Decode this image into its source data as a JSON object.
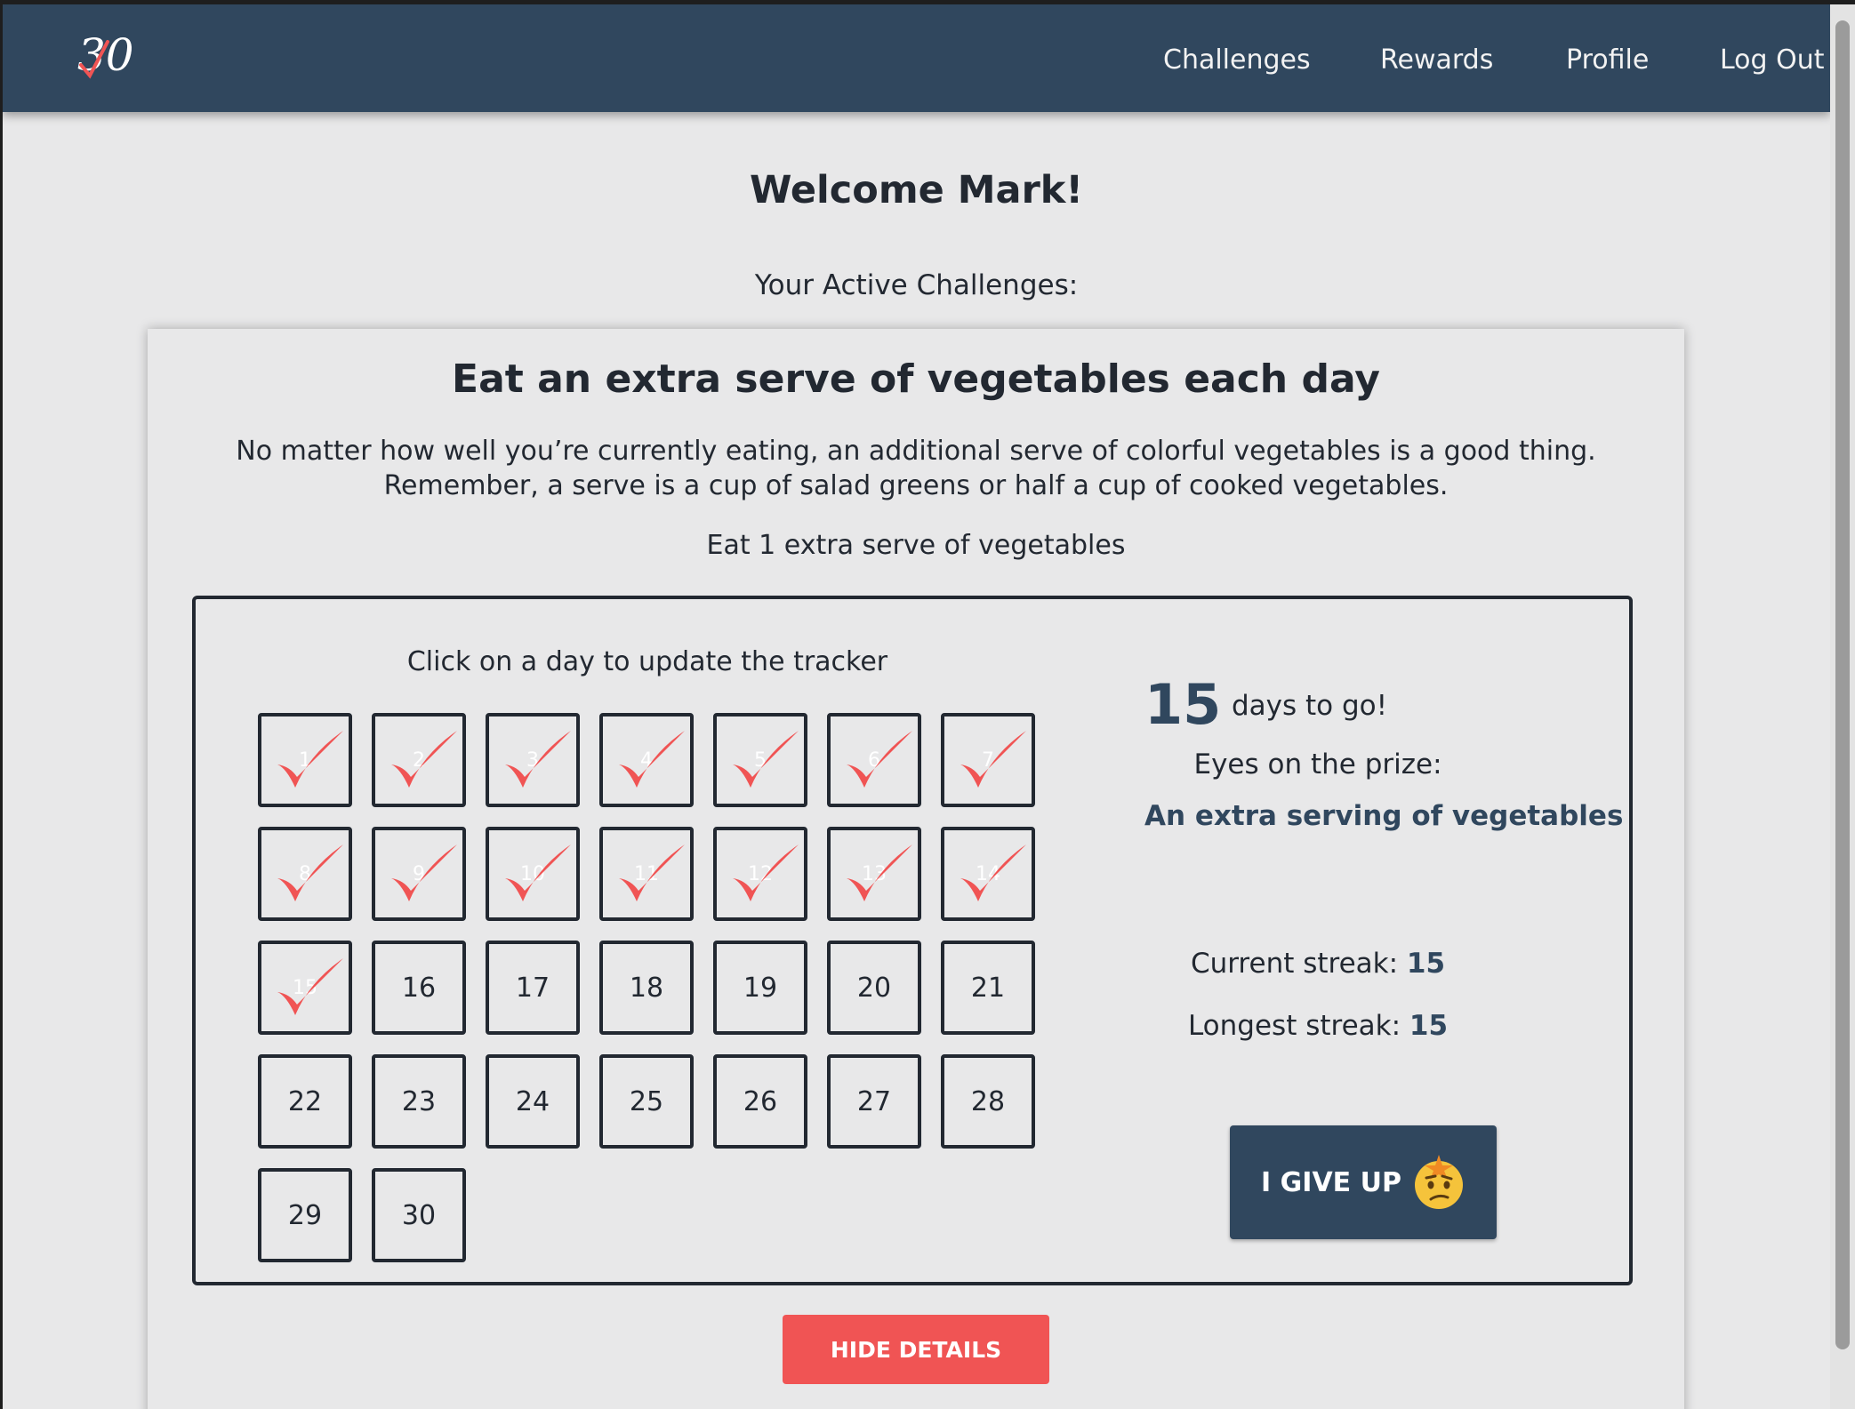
{
  "brand": {
    "logo_text": "30"
  },
  "nav": {
    "links": [
      {
        "label": "Challenges"
      },
      {
        "label": "Rewards"
      },
      {
        "label": "Profile"
      },
      {
        "label": "Log Out"
      }
    ]
  },
  "welcome": "Welcome Mark!",
  "active_label": "Your Active Challenges:",
  "challenge": {
    "title": "Eat an extra serve of vegetables each day",
    "description": "No matter how well you’re currently eating, an additional serve of colorful vegetables is a good thing. Remember, a serve is a cup of salad greens or half a cup of cooked vegetables.",
    "goal": "Eat 1 extra serve of vegetables",
    "tracker": {
      "instruction": "Click on a day to update the tracker",
      "days": [
        {
          "day": "1",
          "done": true
        },
        {
          "day": "2",
          "done": true
        },
        {
          "day": "3",
          "done": true
        },
        {
          "day": "4",
          "done": true
        },
        {
          "day": "5",
          "done": true
        },
        {
          "day": "6",
          "done": true
        },
        {
          "day": "7",
          "done": true
        },
        {
          "day": "8",
          "done": true
        },
        {
          "day": "9",
          "done": true
        },
        {
          "day": "10",
          "done": true
        },
        {
          "day": "11",
          "done": true
        },
        {
          "day": "12",
          "done": true
        },
        {
          "day": "13",
          "done": true
        },
        {
          "day": "14",
          "done": true
        },
        {
          "day": "15",
          "done": true
        },
        {
          "day": "16",
          "done": false
        },
        {
          "day": "17",
          "done": false
        },
        {
          "day": "18",
          "done": false
        },
        {
          "day": "19",
          "done": false
        },
        {
          "day": "20",
          "done": false
        },
        {
          "day": "21",
          "done": false
        },
        {
          "day": "22",
          "done": false
        },
        {
          "day": "23",
          "done": false
        },
        {
          "day": "24",
          "done": false
        },
        {
          "day": "25",
          "done": false
        },
        {
          "day": "26",
          "done": false
        },
        {
          "day": "27",
          "done": false
        },
        {
          "day": "28",
          "done": false
        },
        {
          "day": "29",
          "done": false
        },
        {
          "day": "30",
          "done": false
        }
      ]
    },
    "days_to_go": "15",
    "days_to_go_label": "days to go!",
    "prize_label": "Eyes on the prize:",
    "prize": "An extra serving of vegetables",
    "current_streak_label": "Current streak:",
    "current_streak": "15",
    "longest_streak_label": "Longest streak:",
    "longest_streak": "15",
    "give_up_label": "I GIVE UP",
    "hide_details_label": "HIDE DETAILS"
  },
  "colors": {
    "nav_bg": "#30475e",
    "accent_red": "#f05454",
    "text_dark": "#222831",
    "page_bg": "#e8e8e9"
  }
}
